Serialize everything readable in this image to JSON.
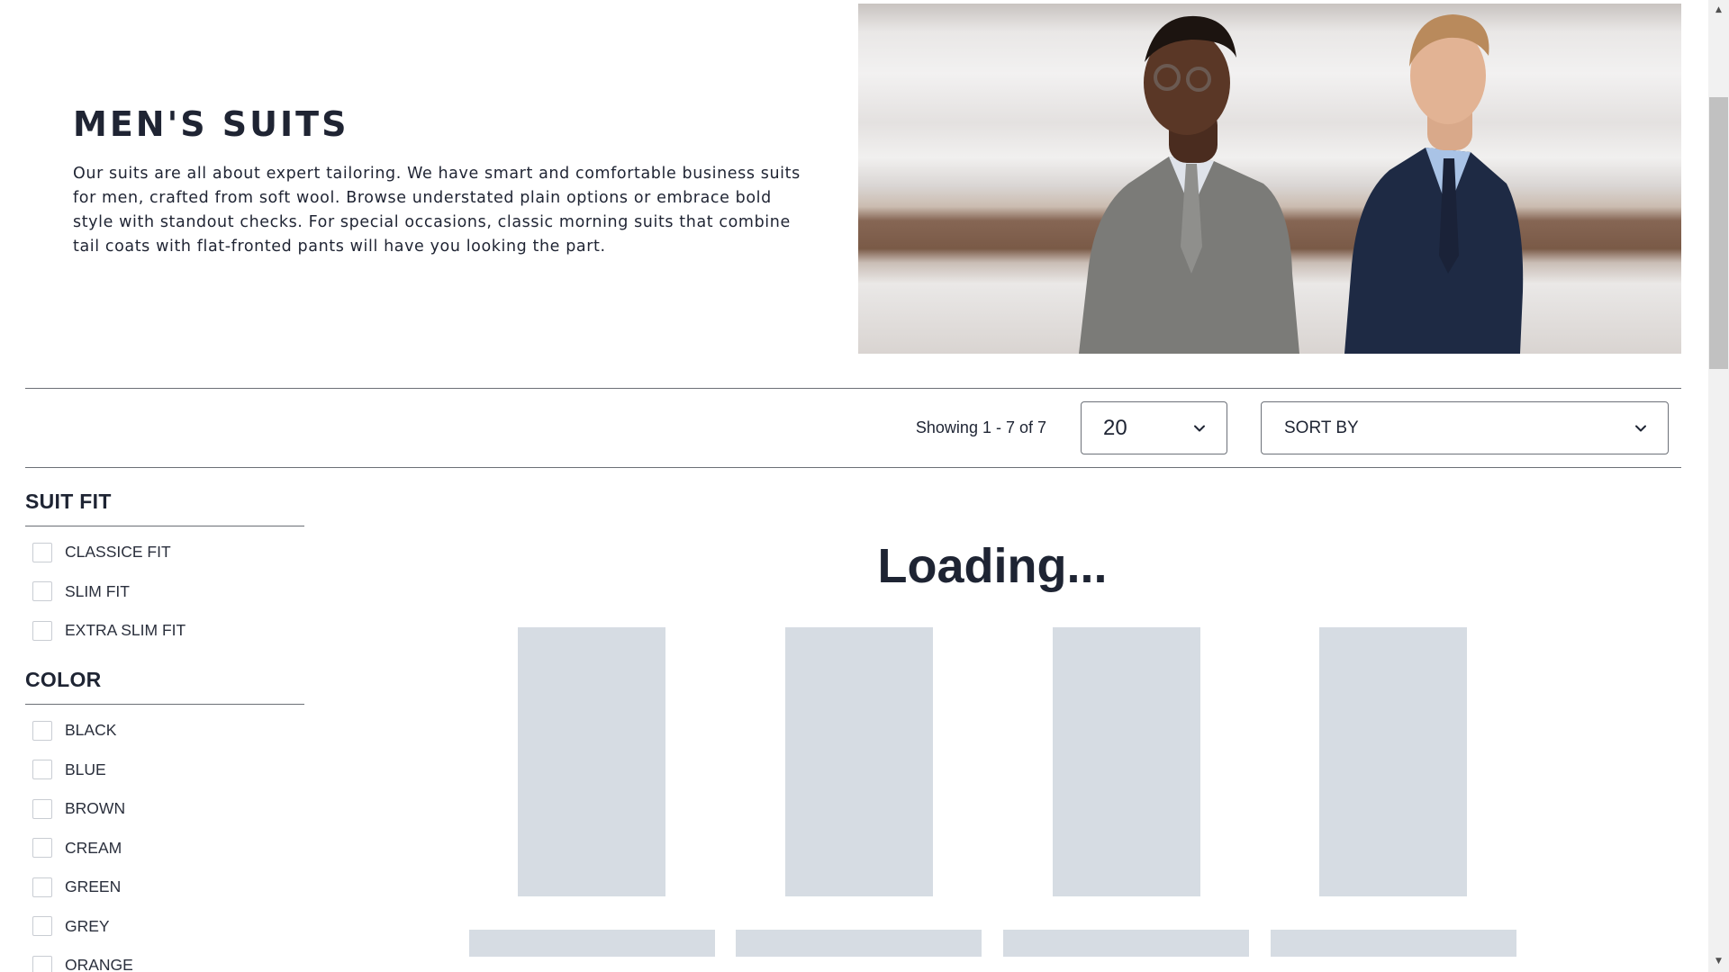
{
  "hero": {
    "title": "MEN'S SUITS",
    "description": "Our suits are all about expert tailoring. We have smart and comfortable business suits for men, crafted from soft wool. Browse understated plain options or embrace bold style with standout checks. For special occasions, classic morning suits that combine tail coats with flat-fronted pants will have you looking the part."
  },
  "toolbar": {
    "showing": "Showing 1 - 7 of 7",
    "per_page": "20",
    "sort": "SORT BY"
  },
  "filters": {
    "fit": {
      "title": "SUIT FIT",
      "items": [
        "CLASSICE FIT",
        "SLIM FIT",
        "EXTRA SLIM FIT"
      ]
    },
    "color": {
      "title": "COLOR",
      "items": [
        "BLACK",
        "BLUE",
        "BROWN",
        "CREAM",
        "GREEN",
        "GREY",
        "ORANGE"
      ]
    }
  },
  "products": {
    "loading_text": "Loading..."
  },
  "colors": {
    "text": "#1e2433",
    "skeleton": "#d6dce3",
    "border": "#6b6f76"
  },
  "icons": {
    "per_page_caret": "chevron-down-icon",
    "sort_caret": "chevron-down-icon",
    "scroll_up": "triangle-up-icon",
    "scroll_down": "triangle-down-icon"
  }
}
